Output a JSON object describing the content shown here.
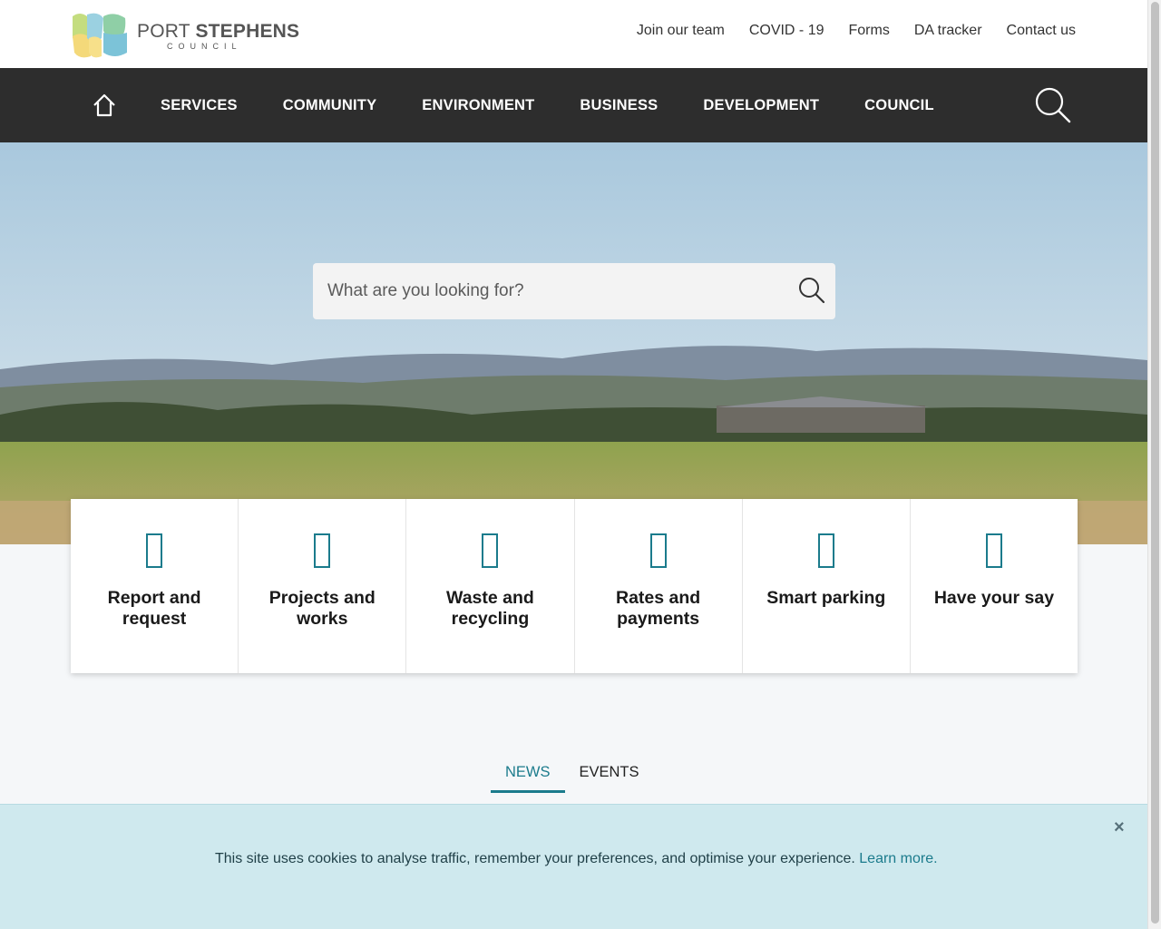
{
  "header": {
    "logo": {
      "word1": "PORT",
      "word2": "STEPHENS",
      "subtitle": "COUNCIL"
    },
    "utility_links": [
      "Join our team",
      "COVID - 19",
      "Forms",
      "DA tracker",
      "Contact us"
    ]
  },
  "nav": {
    "home_icon": "home-icon",
    "items": [
      "SERVICES",
      "COMMUNITY",
      "ENVIRONMENT",
      "BUSINESS",
      "DEVELOPMENT",
      "COUNCIL"
    ],
    "search_icon": "search-icon"
  },
  "hero": {
    "search": {
      "placeholder": "What are you looking for?",
      "icon": "search-icon"
    }
  },
  "quick_links": [
    {
      "line1": "Report and",
      "line2": "request"
    },
    {
      "line1": "Projects and",
      "line2": "works"
    },
    {
      "line1": "Waste and",
      "line2": "recycling"
    },
    {
      "line1": "Rates and",
      "line2": "payments"
    },
    {
      "line1": "Smart parking",
      "line2": ""
    },
    {
      "line1": "Have your say",
      "line2": ""
    }
  ],
  "tabs": [
    {
      "label": "NEWS",
      "active": true
    },
    {
      "label": "EVENTS",
      "active": false
    }
  ],
  "cookie_banner": {
    "message": "This site uses cookies to analyse traffic, remember your preferences, and optimise your experience.",
    "link": "Learn more.",
    "close": "×"
  },
  "colors": {
    "nav_bg": "#2d2d2d",
    "accent_teal": "#1b7b8c",
    "cookie_bg": "#cfe9ee",
    "page_bg": "#f5f7f9"
  }
}
